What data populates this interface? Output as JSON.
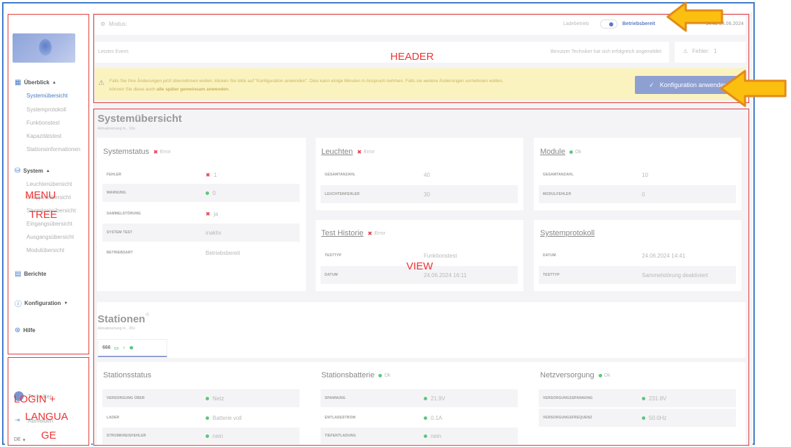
{
  "annotations": {
    "header": "HEADER",
    "menu_tree": [
      "MENU",
      "TREE"
    ],
    "view": "VIEW",
    "login_lang": [
      "LOGIN +",
      "LANGUA",
      "GE"
    ]
  },
  "sidebar": {
    "menu": [
      {
        "label": "Überblick",
        "icon": "grid-icon",
        "items": [
          "Systemübersicht",
          "Systemprotokoll",
          "Funktionstest",
          "Kapazitätstest",
          "Stationsinformationen"
        ]
      },
      {
        "label": "System",
        "icon": "database-icon",
        "items": [
          "Leuchtenübersicht",
          "Gruppenübersicht",
          "Stromkreisübersicht",
          "Eingangsübersicht",
          "Ausgangsübersicht",
          "Modulübersicht"
        ]
      },
      {
        "label": "Berichte",
        "icon": "report-icon"
      },
      {
        "label": "Konfiguration",
        "icon": "info-icon"
      },
      {
        "label": "Hilfe",
        "icon": "help-icon"
      }
    ],
    "user": "Techniker",
    "logout": "Abmelden",
    "language": "DE"
  },
  "header": {
    "mode_label": "Modus:",
    "charge_label": "Ladebetrieb",
    "state_label": "Betriebsbereit",
    "time": "24.06.2024 14:42",
    "last_event_label": "Letztes Event:",
    "last_event": "Benutzer Techniker hat sich erfolgreich angemeldet",
    "errors_label": "Fehler:",
    "errors": "1"
  },
  "warning": {
    "text": "Falls Sie Ihre Änderungen jetzt übernehmen wollen, klicken Sie bitte auf \"Konfiguration anwenden\". Dies kann einige Minuten in Anspruch nehmen. Falls sie weitere Änderungen vornehmen wollen,",
    "text2a": "können Sie diese auch ",
    "text2b": "alle später gemeinsam anwenden",
    "text2c": ".",
    "button": "Konfiguration anwenden"
  },
  "overview": {
    "title": "Systemübersicht",
    "update": "Aktualisierung in.. 10s",
    "systemstatus": {
      "title": "Systemstatus",
      "status": "Error",
      "rows": [
        [
          "FEHLER",
          "1"
        ],
        [
          "WARNUNG",
          "0"
        ],
        [
          "SAMMELSTÖRUNG",
          "ja"
        ],
        [
          "SYSTEM TEST",
          "inaktiv"
        ],
        [
          "BETRIEBSART",
          "Betriebsbereit"
        ]
      ]
    },
    "leuchten": {
      "title": "Leuchten",
      "status": "Error",
      "rows": [
        [
          "GESAMTANZAHL",
          "40"
        ],
        [
          "LEUCHTENFEHLER",
          "30"
        ]
      ]
    },
    "module": {
      "title": "Module",
      "status": "Ok",
      "rows": [
        [
          "GESAMTANZAHL",
          "10"
        ],
        [
          "MODULFEHLER",
          "0"
        ]
      ]
    },
    "test": {
      "title": "Test Historie",
      "status": "Error",
      "rows": [
        [
          "TESTTYP",
          "Funktionstest"
        ],
        [
          "DATUM",
          "24.06.2024 16:11"
        ]
      ]
    },
    "protokoll": {
      "title": "Systemprotokoll",
      "rows": [
        [
          "DATUM",
          "24.06.2024 14:41"
        ],
        [
          "TESTTYP",
          "Sammelstörung deaktiviert"
        ]
      ]
    }
  },
  "stations": {
    "title": "Stationen",
    "update": "Aktualisierung in.. 20s",
    "tab": "666",
    "status": {
      "title": "Stationsstatus",
      "rows": [
        [
          "VERSORGUNG ÜBER",
          "Netz"
        ],
        [
          "LADER",
          "Batterie voll"
        ],
        [
          "STROMKREISFEHLER",
          "nein"
        ]
      ]
    },
    "battery": {
      "title": "Stationsbatterie",
      "status": "Ok",
      "rows": [
        [
          "SPANNUNG",
          "21.9V"
        ],
        [
          "ENTLADESTROM",
          "0.1A"
        ],
        [
          "TIEFENTLADUNG",
          "nein"
        ]
      ]
    },
    "power": {
      "title": "Netzversorgung",
      "status": "Ok",
      "rows": [
        [
          "VERSORGUNGSSPANNUNG",
          "231.8V"
        ],
        [
          "VERSORGUNGSFREQUENZ",
          "50.0Hz"
        ]
      ]
    }
  }
}
